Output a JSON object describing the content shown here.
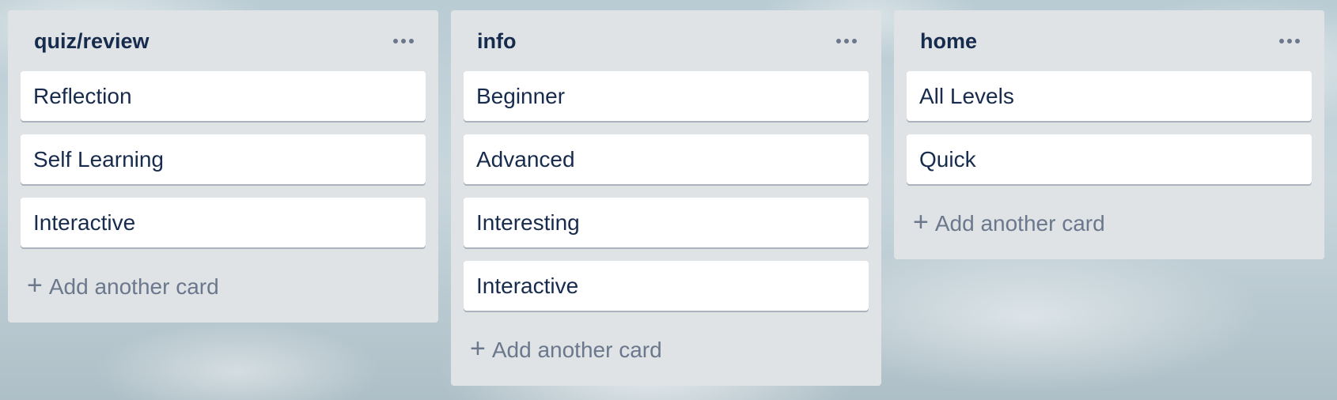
{
  "board": {
    "lists": [
      {
        "title": "quiz/review",
        "cards": [
          "Reflection",
          "Self Learning",
          "Interactive"
        ],
        "add_label": "Add another card"
      },
      {
        "title": "info",
        "cards": [
          "Beginner",
          "Advanced",
          "Interesting",
          "Interactive"
        ],
        "add_label": "Add another card"
      },
      {
        "title": "home",
        "cards": [
          "All Levels",
          "Quick"
        ],
        "add_label": "Add another card"
      }
    ],
    "icons": {
      "list_menu": "more-horizontal-icon",
      "add": "plus-icon"
    }
  }
}
